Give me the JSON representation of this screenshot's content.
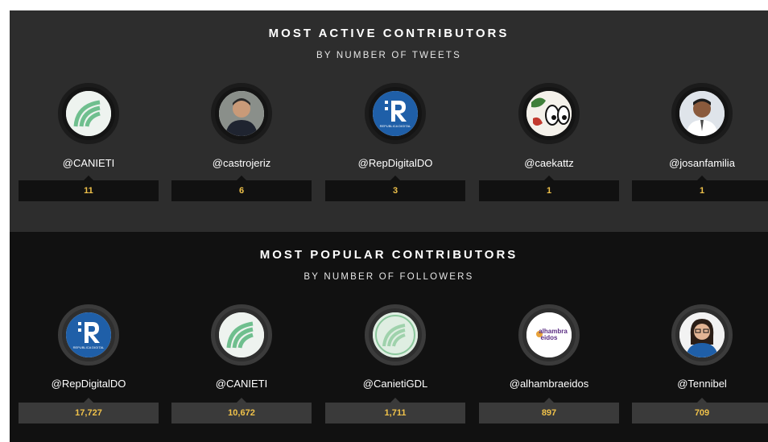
{
  "active": {
    "title": "MOST ACTIVE CONTRIBUTORS",
    "subtitle": "BY NUMBER OF TWEETS",
    "contributors": [
      {
        "handle": "@CANIETI",
        "count": "11",
        "avatar": "canieti-logo"
      },
      {
        "handle": "@castrojeriz",
        "count": "6",
        "avatar": "man-portrait"
      },
      {
        "handle": "@RepDigitalDO",
        "count": "3",
        "avatar": "republica-digital-logo"
      },
      {
        "handle": "@caekattz",
        "count": "1",
        "avatar": "cartoon-eyes"
      },
      {
        "handle": "@josanfamilia",
        "count": "1",
        "avatar": "man-portrait"
      }
    ]
  },
  "popular": {
    "title": "MOST POPULAR CONTRIBUTORS",
    "subtitle": "BY NUMBER OF FOLLOWERS",
    "contributors": [
      {
        "handle": "@RepDigitalDO",
        "count": "17,727",
        "avatar": "republica-digital-logo"
      },
      {
        "handle": "@CANIETI",
        "count": "10,672",
        "avatar": "canieti-logo"
      },
      {
        "handle": "@CanietiGDL",
        "count": "1,711",
        "avatar": "canieti-gdl-logo"
      },
      {
        "handle": "@alhambraeidos",
        "count": "897",
        "avatar": "alhambra-eidos-logo"
      },
      {
        "handle": "@Tennibel",
        "count": "709",
        "avatar": "woman-portrait"
      }
    ]
  },
  "logo_text": {
    "republica": "REPUBLICA DIGITAL",
    "alhambra_line1": "alhambra",
    "alhambra_line2": "eidos"
  },
  "colors": {
    "count_text": "#f0c24a",
    "active_bg": "#2d2d2d",
    "popular_bg": "#111111",
    "rd_blue": "#1f5fa8",
    "canieti_green": "#6fbf8e"
  }
}
